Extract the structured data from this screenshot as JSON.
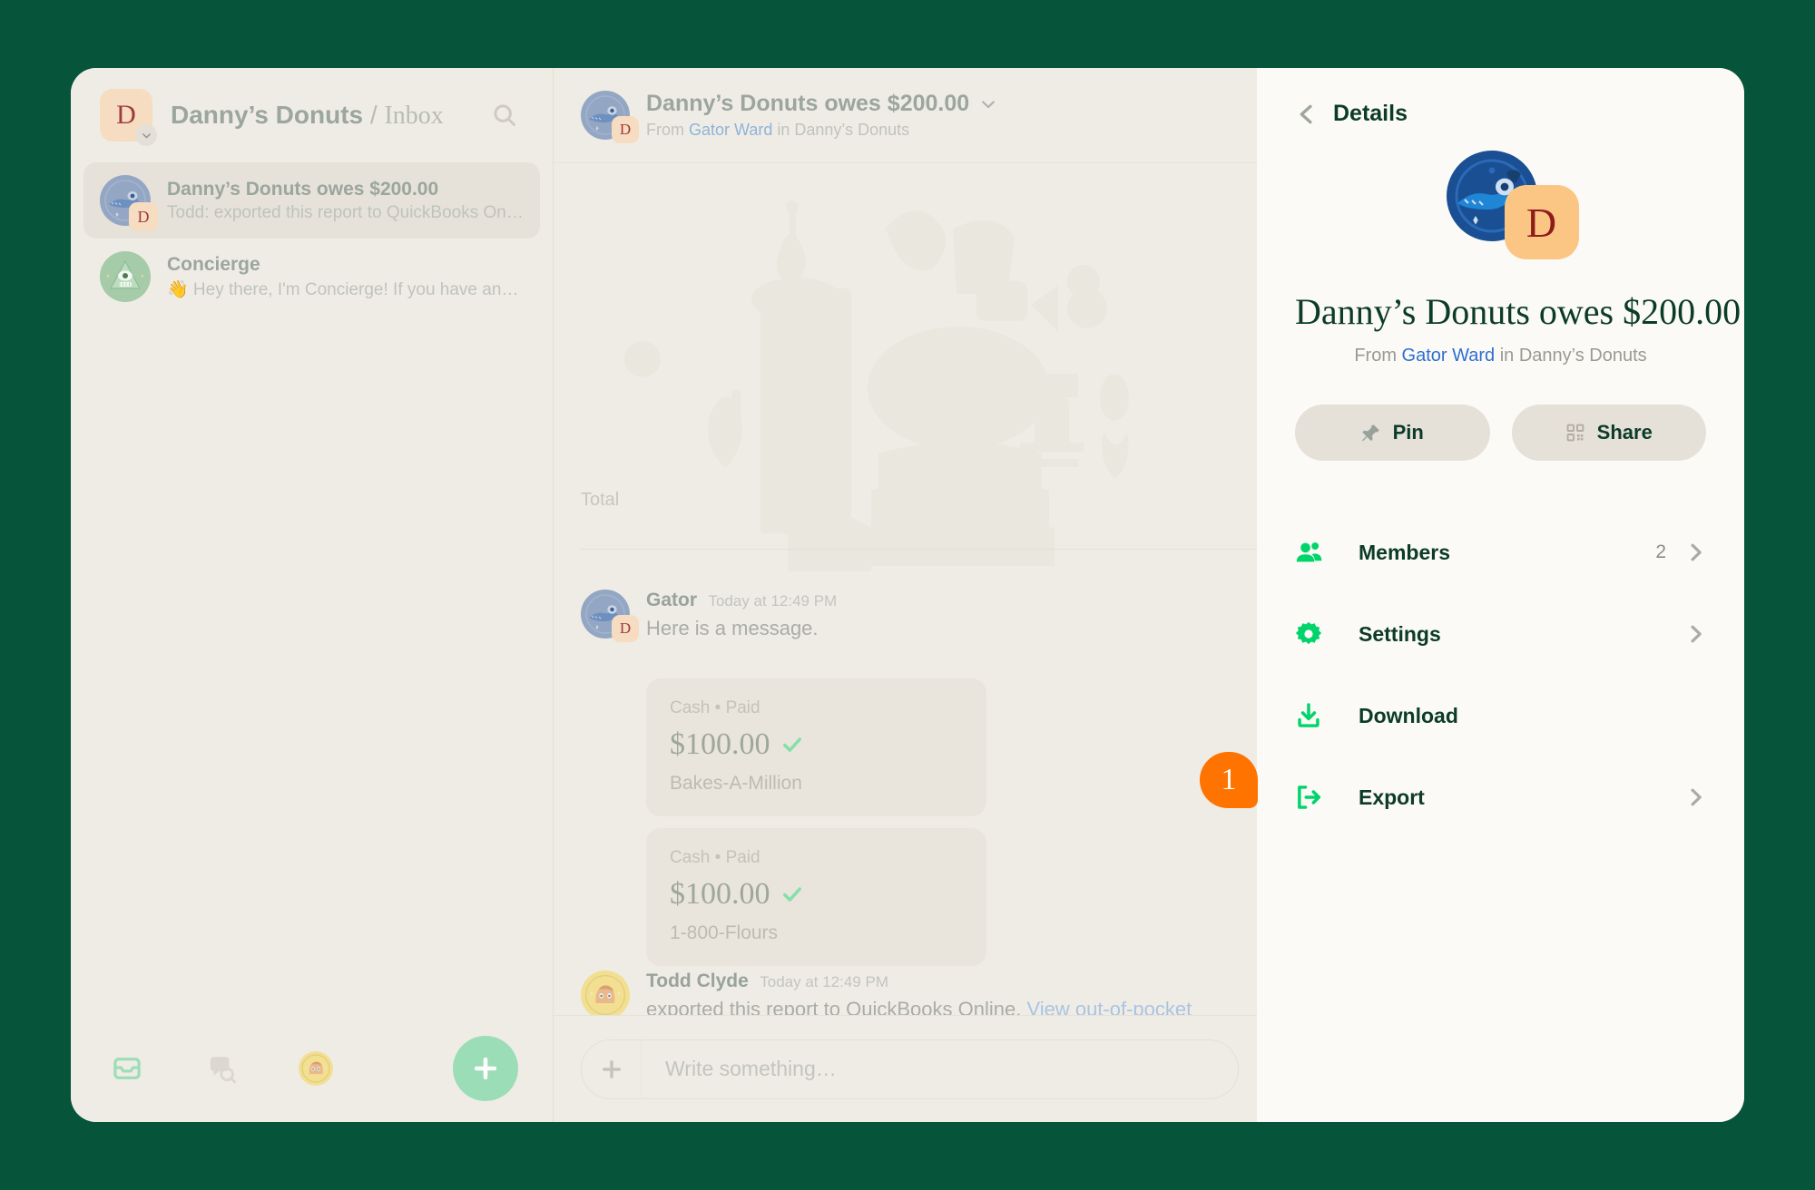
{
  "theme": {
    "page_bg": "#06543A",
    "window_bg": "#EFECE5",
    "panel_bg": "#FBFAF7",
    "accent_green": "#00D46A",
    "accent_dark": "#0C3B27",
    "badge_orange": "#FF7300",
    "link_blue": "#2F6FD0",
    "mint": "#9BDDB6"
  },
  "sidebar": {
    "workspace_initial": "D",
    "workspace_name": "Danny’s Donuts",
    "separator": "/",
    "section": "Inbox",
    "search_icon": "search-icon",
    "caret_icon": "chevron-down-icon",
    "conversations": [
      {
        "title": "Danny’s Donuts owes $200.00",
        "preview": "Todd: exported this report to QuickBooks Online…",
        "badge": "D",
        "avatar": "gator-avatar",
        "active": true
      },
      {
        "title": "Concierge",
        "preview": "👋 Hey there, I'm Concierge! If you have any que…",
        "badge": "",
        "avatar": "concierge-avatar",
        "active": false
      }
    ],
    "bottom_nav": [
      {
        "icon": "inbox-icon",
        "label": "Inbox",
        "active": true
      },
      {
        "icon": "search-chat-icon",
        "label": "Search",
        "active": false
      },
      {
        "icon": "account-avatar-icon",
        "label": "Account",
        "active": false
      }
    ],
    "fab": {
      "icon": "plus-icon",
      "label": "New"
    }
  },
  "chat": {
    "header": {
      "title": "Danny’s Donuts owes $200.00",
      "caret_icon": "chevron-down-icon",
      "from_prefix": "From",
      "from_user": "Gator Ward",
      "in_text": "in Danny’s Donuts",
      "badge": "D"
    },
    "report": {
      "total_label": "Total"
    },
    "messages": [
      {
        "author": "Gator",
        "time": "Today at 12:49 PM",
        "text": "Here is a message.",
        "badge": "D",
        "avatar": "gator-avatar"
      },
      {
        "author": "Todd Clyde",
        "time": "Today at 12:49 PM",
        "text": "exported this report to QuickBooks Online.",
        "link_text": "View out-of-pocket expenses",
        "avatar": "todd-avatar"
      }
    ],
    "expenses": [
      {
        "meta": "Cash • Paid",
        "amount": "$100.00",
        "status_icon": "check-icon",
        "vendor": "Bakes-A-Million"
      },
      {
        "meta": "Cash • Paid",
        "amount": "$100.00",
        "status_icon": "check-icon",
        "vendor": "1-800-Flours"
      }
    ],
    "composer": {
      "plus_icon": "plus-icon",
      "placeholder": "Write something…",
      "value": ""
    }
  },
  "details": {
    "back_icon": "chevron-left-icon",
    "title": "Details",
    "avatar": "gator-avatar-large",
    "badge_initial": "D",
    "heading": "Danny’s Donuts owes $200.00",
    "from_prefix": "From",
    "from_user": "Gator Ward",
    "in_text": "in Danny’s Donuts",
    "actions": [
      {
        "label": "Pin",
        "icon": "pin-icon"
      },
      {
        "label": "Share",
        "icon": "qr-code-icon"
      }
    ],
    "rows": [
      {
        "label": "Members",
        "icon": "members-icon",
        "count": "2",
        "chevron": true
      },
      {
        "label": "Settings",
        "icon": "gear-icon",
        "count": "",
        "chevron": true
      },
      {
        "label": "Download",
        "icon": "download-icon",
        "count": "",
        "chevron": false
      },
      {
        "label": "Export",
        "icon": "export-icon",
        "count": "",
        "chevron": true
      }
    ]
  },
  "overlay": {
    "step_badge": "1"
  }
}
